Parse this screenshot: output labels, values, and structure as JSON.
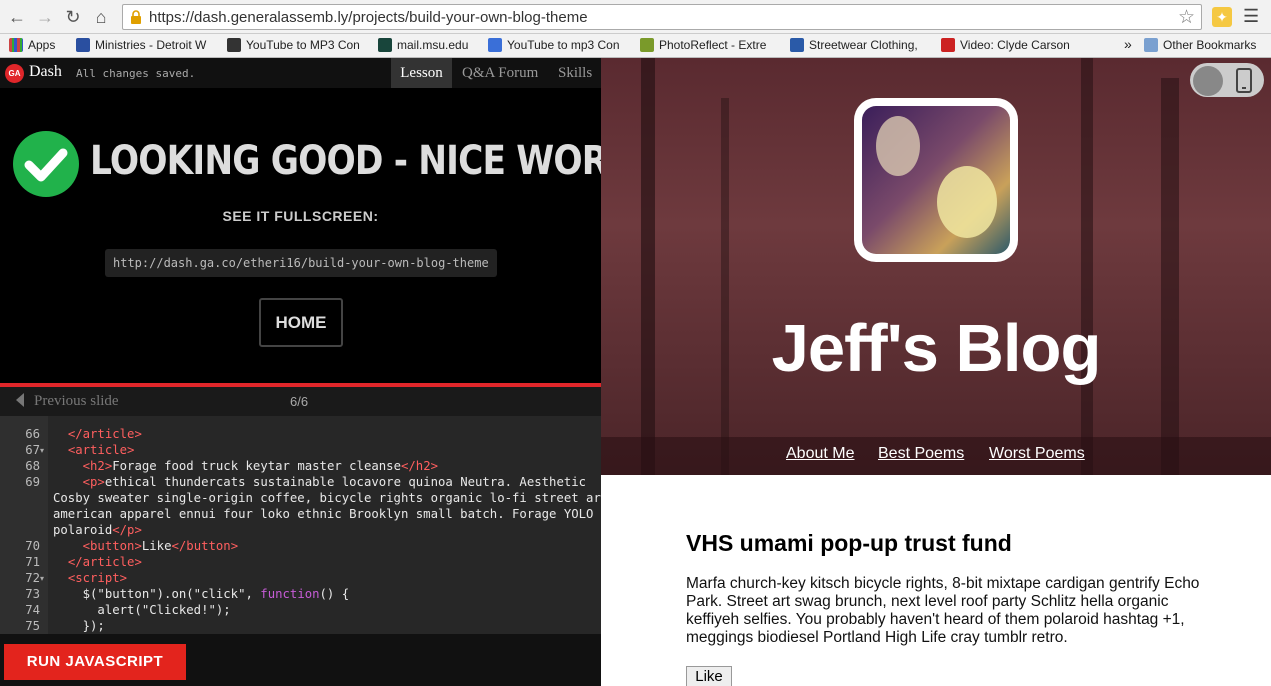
{
  "browser": {
    "url": "https://dash.generalassemb.ly/projects/build-your-own-blog-theme",
    "bookmarks": [
      {
        "label": "Apps",
        "color": "#c44"
      },
      {
        "label": "Ministries - Detroit W",
        "color": "#2a4fa0"
      },
      {
        "label": "YouTube to MP3 Con",
        "color": "#333"
      },
      {
        "label": "mail.msu.edu",
        "color": "#18453b"
      },
      {
        "label": "YouTube to mp3 Con",
        "color": "#3a6fd8"
      },
      {
        "label": "PhotoReflect - Extre",
        "color": "#7a9a2a"
      },
      {
        "label": "Streetwear Clothing,",
        "color": "#2a5aa8"
      },
      {
        "label": "Video: Clyde Carson",
        "color": "#c22"
      }
    ],
    "bookmarks_overflow": "»",
    "other_bookmarks": "Other Bookmarks"
  },
  "dash": {
    "logo": "GA",
    "name": "Dash",
    "save_status": "All changes saved.",
    "tabs": [
      "Lesson",
      "Q&A Forum",
      "Skills"
    ],
    "headline": "LOOKING GOOD - NICE WORK!",
    "see_fullscreen": "SEE IT FULLSCREEN:",
    "fullscreen_link": "http://dash.ga.co/etheri16/build-your-own-blog-theme",
    "home_label": "HOME",
    "prev_label": "Previous slide",
    "page_counter": "6/6",
    "run_label": "RUN JAVASCRIPT"
  },
  "code_lines": [
    {
      "n": "66",
      "html": "  <span class='tag'>&lt;/article&gt;</span>"
    },
    {
      "n": "67",
      "html": "  <span class='tag'>&lt;article&gt;</span>"
    },
    {
      "n": "68",
      "html": "    <span class='tag'>&lt;h2&gt;</span>Forage food truck keytar master cleanse<span class='tag'>&lt;/h2&gt;</span>"
    },
    {
      "n": "69",
      "html": "    <span class='tag'>&lt;p&gt;</span>ethical thundercats sustainable locavore quinoa Neutra. Aesthetic"
    },
    {
      "n": "",
      "html": "Cosby sweater single-origin coffee, bicycle rights organic lo-fi street art"
    },
    {
      "n": "",
      "html": "american apparel ennui four loko ethnic Brooklyn small batch. Forage YOLO"
    },
    {
      "n": "",
      "html": "polaroid<span class='tag'>&lt;/p&gt;</span>"
    },
    {
      "n": "70",
      "html": "    <span class='tag'>&lt;button&gt;</span>Like<span class='tag'>&lt;/button&gt;</span>"
    },
    {
      "n": "71",
      "html": "  <span class='tag'>&lt;/article&gt;</span>"
    },
    {
      "n": "72",
      "html": "  <span class='tag'>&lt;script&gt;</span>"
    },
    {
      "n": "73",
      "html": "    $(\"button\").on(\"click\", <span class='kw'>function</span>() {"
    },
    {
      "n": "74",
      "html": "      alert(\"Clicked!\");"
    },
    {
      "n": "75",
      "html": "    });"
    }
  ],
  "blog": {
    "title": "Jeff's Blog",
    "nav": [
      "About Me",
      "Best Poems",
      "Worst Poems"
    ],
    "post_title": "VHS umami pop-up trust fund",
    "post_body": "Marfa church-key kitsch bicycle rights, 8-bit mixtape cardigan gentrify Echo Park. Street art swag brunch, next level roof party Schlitz hella organic keffiyeh selfies. You probably haven't heard of them polaroid hashtag +1, meggings biodiesel Portland High Life cray tumblr retro.",
    "like_label": "Like"
  }
}
